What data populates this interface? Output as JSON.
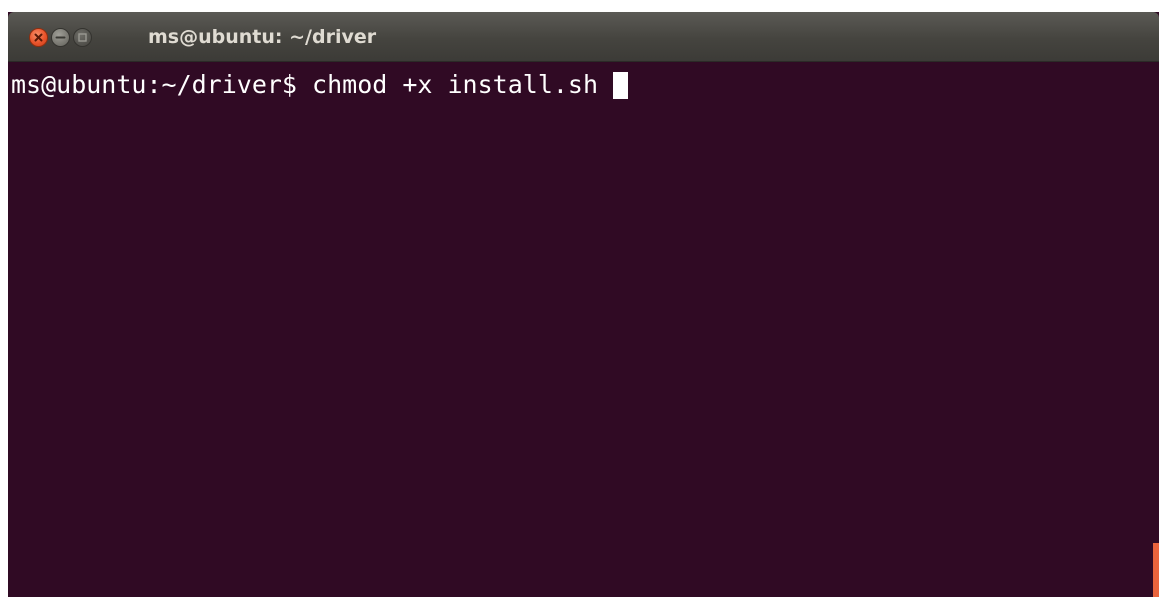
{
  "window": {
    "title": "ms@ubuntu: ~/driver"
  },
  "terminal": {
    "prompt": "ms@ubuntu:~/driver$",
    "command": "chmod +x install.sh"
  },
  "colors": {
    "background": "#300a24",
    "titlebar": "#45443f",
    "close_button": "#e9532a",
    "text": "#ffffff",
    "scroll_indicator": "#e9643d"
  },
  "icons": {
    "close": "close-icon",
    "minimize": "minimize-icon",
    "maximize": "maximize-icon"
  }
}
